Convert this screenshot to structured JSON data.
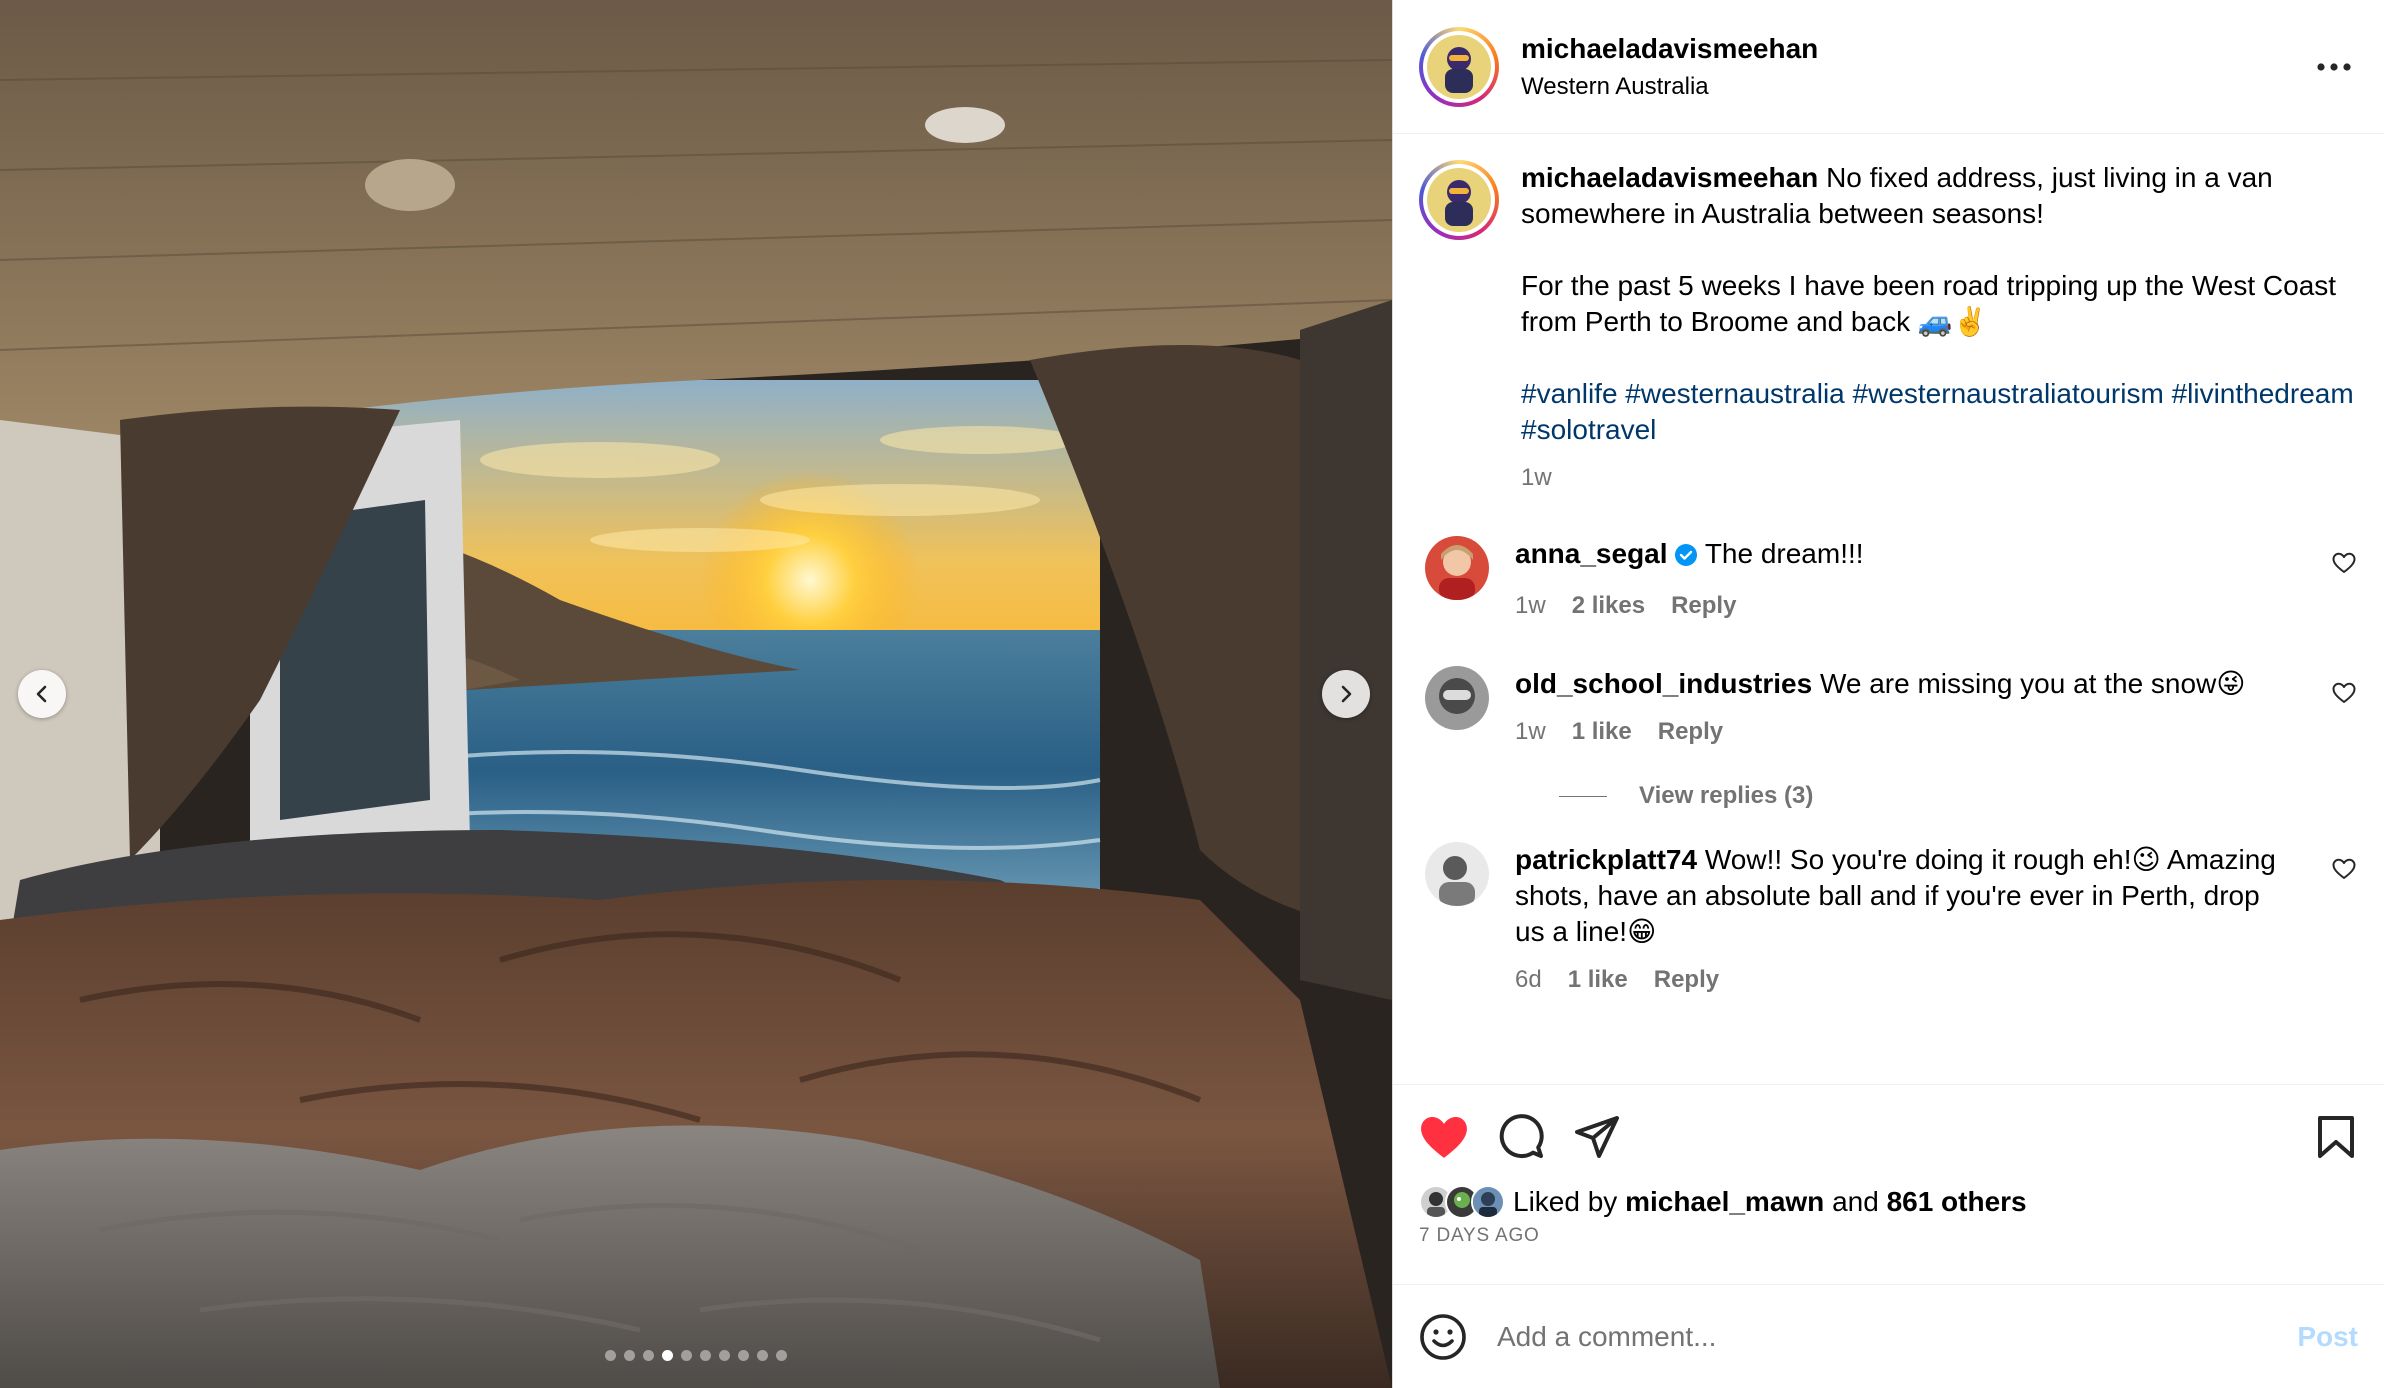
{
  "post": {
    "username": "michaeladavismeehan",
    "location": "Western Australia",
    "caption": {
      "username": "michaeladavismeehan",
      "line1": "No fixed address, just living in a van somewhere in Australia between seasons!",
      "line2": "For the past 5 weeks I have been road tripping up the West Coast from Perth to Broome and back 🚙✌️",
      "hashtags": [
        "#vanlife",
        "#westernaustralia",
        "#westernaustraliatourism",
        "#livinthedream",
        "#solotravel"
      ],
      "time": "1w"
    }
  },
  "comments": [
    {
      "username": "anna_segal",
      "verified": true,
      "text": "The dream!!!",
      "time": "1w",
      "likes": "2 likes",
      "reply": "Reply"
    },
    {
      "username": "old_school_industries",
      "verified": false,
      "text": "We are missing you at the snow😜",
      "time": "1w",
      "likes": "1 like",
      "reply": "Reply",
      "view_replies": "View replies (3)"
    },
    {
      "username": "patrickplatt74",
      "verified": false,
      "text": "Wow!! So you're doing it rough eh!😉 Amazing shots, have an absolute ball and if you're ever in Perth, drop us a line!😁",
      "time": "6d",
      "likes": "1 like",
      "reply": "Reply"
    }
  ],
  "likes": {
    "prefix": "Liked by",
    "user": "michael_mawn",
    "conjunction": "and",
    "others": "861 others",
    "date": "7 DAYS AGO"
  },
  "comment_box": {
    "placeholder": "Add a comment...",
    "post_label": "Post"
  },
  "carousel": {
    "total": 10,
    "active_index": 3
  },
  "colors": {
    "like_red": "#ff3040",
    "hashtag": "#00376b",
    "muted": "#737373",
    "post_disabled": "#b3dbff",
    "verified": "#0095f6"
  },
  "icons": {
    "more": "more-horizontal-icon",
    "like": "heart-filled-icon",
    "comment": "comment-bubble-icon",
    "share": "paper-plane-icon",
    "save": "bookmark-icon",
    "emoji": "emoji-smile-icon",
    "prev": "chevron-left-icon",
    "next": "chevron-right-icon"
  }
}
